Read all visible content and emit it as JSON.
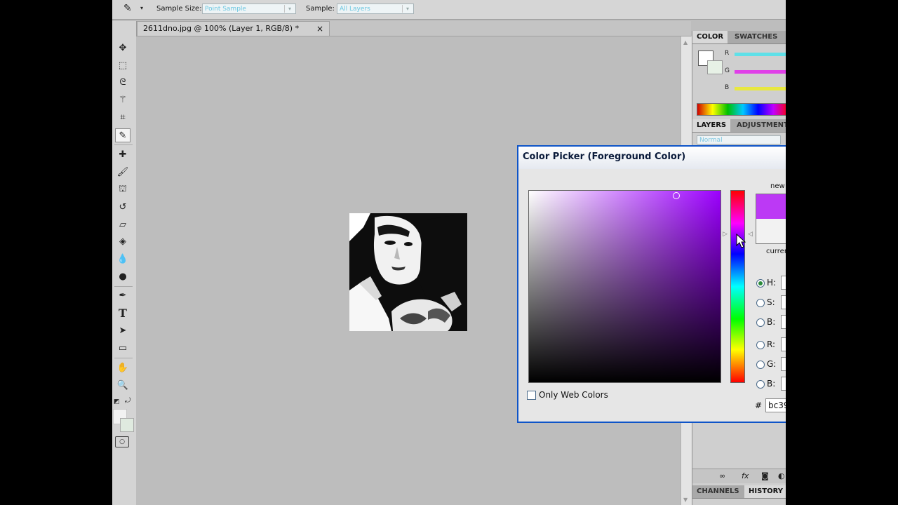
{
  "options_bar": {
    "sample_size_label": "Sample Size:",
    "sample_size_value": "Point Sample",
    "sample_label": "Sample:",
    "sample_value": "All Layers",
    "tool_icon": "eyedropper-icon"
  },
  "document": {
    "tab_title": "2611dno.jpg @ 100% (Layer 1, RGB/8) *",
    "close_glyph": "×"
  },
  "toolbox": {
    "tools": [
      "move-icon",
      "marquee-icon",
      "lasso-icon",
      "magic-wand-icon",
      "crop-icon",
      "eyedropper-icon",
      "healing-brush-icon",
      "brush-icon",
      "clone-stamp-icon",
      "history-brush-icon",
      "eraser-icon",
      "paint-bucket-icon",
      "blur-icon",
      "dodge-icon",
      "pen-icon",
      "type-icon",
      "path-selection-icon",
      "shape-icon",
      "hand-icon",
      "zoom-icon"
    ],
    "active_tool": "eyedropper-icon"
  },
  "color_panel": {
    "tabs": [
      "COLOR",
      "SWATCHES"
    ],
    "channels": [
      "R",
      "G",
      "B"
    ],
    "channel_colors": [
      "#5fe0e8",
      "#e040e8",
      "#e8e840"
    ]
  },
  "layers_panel": {
    "tabs": [
      "LAYERS",
      "ADJUSTMENTS"
    ],
    "blend_mode": "Normal"
  },
  "bottom_panel": {
    "tabs": [
      "CHANNELS",
      "HISTORY"
    ]
  },
  "color_picker": {
    "title": "Color Picker (Foreground Color)",
    "new_label": "new",
    "current_label": "current",
    "new_color": "#bc39f5",
    "current_color": "#f2f2f2",
    "fields": [
      {
        "label": "H:",
        "selected": true
      },
      {
        "label": "S:",
        "selected": false
      },
      {
        "label": "B:",
        "selected": false
      },
      {
        "label": "R:",
        "selected": false
      },
      {
        "label": "G:",
        "selected": false
      },
      {
        "label": "B:",
        "selected": false
      }
    ],
    "only_web_colors_label": "Only Web Colors",
    "hex_prefix": "#",
    "hex_value": "bc39"
  }
}
